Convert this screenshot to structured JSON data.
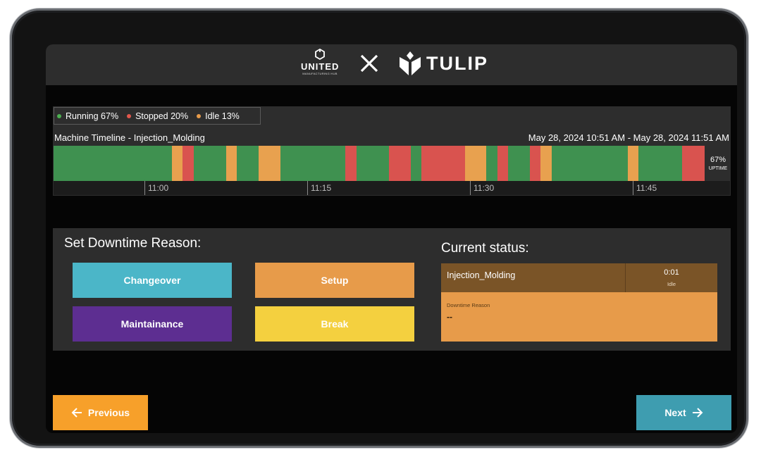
{
  "header": {
    "umh_logo_text": "UNITED",
    "umh_logo_subtext": "MANUFACTURING HUB",
    "separator_icon": "cross-icon",
    "tulip_logo_text": "TULIP"
  },
  "timeline": {
    "legend": [
      {
        "label": "Running 67%",
        "color": "#4caf50"
      },
      {
        "label": "Stopped 20%",
        "color": "#e2574c"
      },
      {
        "label": "Idle 13%",
        "color": "#e79b4a"
      }
    ],
    "title": "Machine Timeline - Injection_Molding",
    "range": "May 28, 2024 10:51 AM - May 28, 2024 11:51 AM",
    "uptime_value": "67%",
    "uptime_label": "UPTIME",
    "ticks": [
      "11:00",
      "11:15",
      "11:30",
      "11:45"
    ],
    "colors": {
      "running": "#3f9150",
      "stopped": "#d9534f",
      "idle": "#e8a14f"
    },
    "segments_minutes": [
      {
        "state": "running",
        "start": 0,
        "end": 10.9
      },
      {
        "state": "idle",
        "start": 10.9,
        "end": 11.9
      },
      {
        "state": "stopped",
        "start": 11.9,
        "end": 12.9
      },
      {
        "state": "running",
        "start": 12.9,
        "end": 15.9
      },
      {
        "state": "idle",
        "start": 15.9,
        "end": 16.9
      },
      {
        "state": "running",
        "start": 16.9,
        "end": 18.9
      },
      {
        "state": "idle",
        "start": 18.9,
        "end": 20.9
      },
      {
        "state": "running",
        "start": 20.9,
        "end": 26.9
      },
      {
        "state": "stopped",
        "start": 26.9,
        "end": 27.9
      },
      {
        "state": "running",
        "start": 27.9,
        "end": 30.9
      },
      {
        "state": "stopped",
        "start": 30.9,
        "end": 32.9
      },
      {
        "state": "running",
        "start": 32.9,
        "end": 33.9
      },
      {
        "state": "stopped",
        "start": 33.9,
        "end": 37.9
      },
      {
        "state": "idle",
        "start": 37.9,
        "end": 39.9
      },
      {
        "state": "running",
        "start": 39.9,
        "end": 40.9
      },
      {
        "state": "stopped",
        "start": 40.9,
        "end": 41.9
      },
      {
        "state": "running",
        "start": 41.9,
        "end": 43.9
      },
      {
        "state": "stopped",
        "start": 43.9,
        "end": 44.9
      },
      {
        "state": "idle",
        "start": 44.9,
        "end": 45.9
      },
      {
        "state": "running",
        "start": 45.9,
        "end": 52.9
      },
      {
        "state": "idle",
        "start": 52.9,
        "end": 53.9
      },
      {
        "state": "running",
        "start": 53.9,
        "end": 57.9
      },
      {
        "state": "stopped",
        "start": 57.9,
        "end": 60
      }
    ]
  },
  "downtime": {
    "title": "Set Downtime Reason:",
    "buttons": [
      {
        "label": "Changeover",
        "color": "#4bb6c8"
      },
      {
        "label": "Setup",
        "color": "#e79b4a"
      },
      {
        "label": "Maintainance",
        "color": "#5d2e91"
      },
      {
        "label": "Break",
        "color": "#f4d03f"
      }
    ]
  },
  "status": {
    "title": "Current status:",
    "machine": "Injection_Molding",
    "time": "0:01",
    "state": "Idle",
    "reason_label": "Downtime Reason",
    "reason_value": "--"
  },
  "nav": {
    "previous_label": "Previous",
    "previous_color": "#f7a02a",
    "next_label": "Next",
    "next_color": "#3e9db0"
  }
}
